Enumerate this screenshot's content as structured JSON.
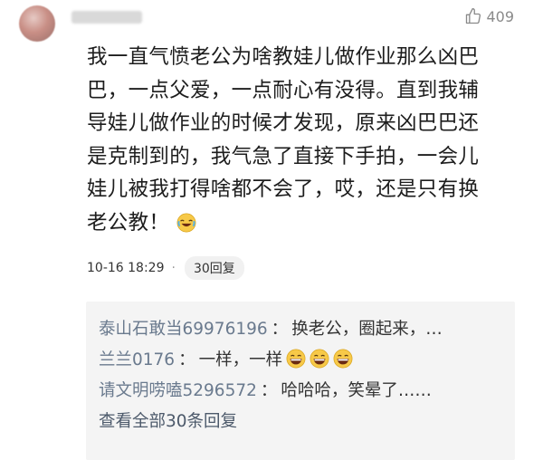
{
  "like_count": "409",
  "comment": {
    "lines": [
      "我一直气愤老公为啥教娃儿做作业那么凶巴",
      "巴，一点父爱，一点耐心有没得。直到我辅",
      "导娃儿做作业的时候才发现，原来凶巴巴还",
      "是克制到的，我气急了直接下手拍，一会儿",
      "娃儿被我打得啥都不会了，哎，还是只有换",
      "老公教！"
    ],
    "emoji_icon": "laugh-cry-emoji-icon"
  },
  "meta": {
    "timestamp": "10-16 18:29",
    "dot": "·",
    "reply_count_label": "30回复"
  },
  "replies": [
    {
      "name": "泰山石敢当69976196",
      "sep": "：",
      "text": "换老公，圈起来，…",
      "emojis": []
    },
    {
      "name": "兰兰0176",
      "sep": "：",
      "text": "一样，一样",
      "emojis": [
        "grin-emoji-icon",
        "grin-emoji-icon",
        "grin-emoji-icon"
      ]
    },
    {
      "name": "请文明唠嗑5296572",
      "sep": "：",
      "text": "哈哈哈，笑晕了……",
      "emojis": []
    }
  ],
  "view_all_label": "查看全部30条回复",
  "colors": {
    "reply_name": "#6a7a8e",
    "reply_bg": "#f4f4f4",
    "like_gray": "#8a8a8a"
  }
}
